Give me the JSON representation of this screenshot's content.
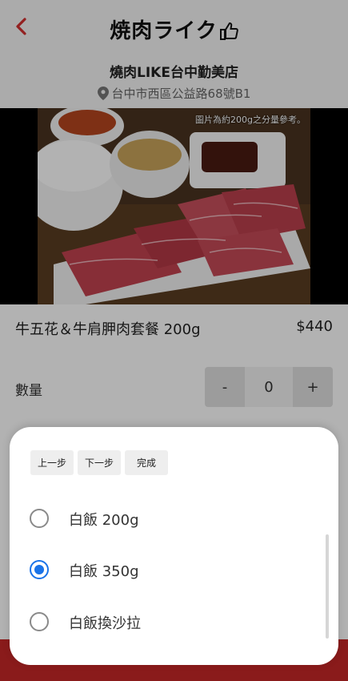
{
  "header": {
    "logo_text": "焼肉ライク",
    "store_name": "燒肉LIKE台中勤美店",
    "address": "台中市西區公益路68號B1"
  },
  "photo": {
    "note": "圖片為約200g之分量參考。"
  },
  "product": {
    "name": "牛五花＆牛肩胛肉套餐 200g",
    "price": "$440"
  },
  "quantity": {
    "label": "數量",
    "minus": "-",
    "value": "0",
    "plus": "+"
  },
  "picker": {
    "prev_label": "上一步",
    "next_label": "下一步",
    "done_label": "完成",
    "options": [
      {
        "label": "白飯 200g",
        "selected": false
      },
      {
        "label": "白飯 350g",
        "selected": true
      },
      {
        "label": "白飯換沙拉",
        "selected": false
      }
    ]
  },
  "colors": {
    "accent": "#1a73e8",
    "brand_red": "#c62828"
  },
  "icons": {
    "back": "chevron-left-icon",
    "location": "map-pin-icon",
    "logo_thumb": "thumbs-up-icon"
  }
}
